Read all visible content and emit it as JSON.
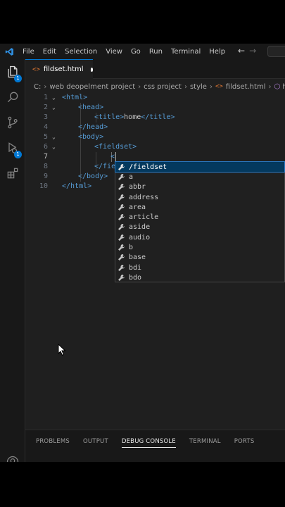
{
  "menu": [
    "File",
    "Edit",
    "Selection",
    "View",
    "Go",
    "Run",
    "Terminal",
    "Help"
  ],
  "nav": {
    "back": "←",
    "forward": "→"
  },
  "activity": {
    "explorer_badge": "1",
    "debug_badge": "1"
  },
  "tab": {
    "icon": "<>",
    "label": "fildset.html"
  },
  "breadcrumb": {
    "drive": "C:",
    "parts": [
      "web deopelment project",
      "css project",
      "style"
    ],
    "file": "fildset.html",
    "element": "html"
  },
  "editor": {
    "line_numbers": [
      "1",
      "2",
      "3",
      "4",
      "5",
      "6",
      "7",
      "8",
      "9",
      "10"
    ],
    "lines": {
      "l1": "<html>",
      "l2": "<head>",
      "l3_open": "<title>",
      "l3_text": "home",
      "l3_close": "</title>",
      "l4": "</head>",
      "l5": "<body>",
      "l6": "<fieldset>",
      "l7": "<",
      "l8": "</fie",
      "l9": "</body>",
      "l10": "</html>"
    }
  },
  "suggestions": {
    "first_prefix": "/",
    "first_rest": "fieldset",
    "items": [
      "a",
      "abbr",
      "address",
      "area",
      "article",
      "aside",
      "audio",
      "b",
      "base",
      "bdi",
      "bdo"
    ]
  },
  "panel": {
    "tabs": [
      "PROBLEMS",
      "OUTPUT",
      "DEBUG CONSOLE",
      "TERMINAL",
      "PORTS"
    ],
    "active": "DEBUG CONSOLE"
  },
  "colors": {
    "accent": "#0078d4",
    "tag": "#569cd6",
    "html_icon": "#e37933",
    "bg": "#1f1f1f"
  }
}
